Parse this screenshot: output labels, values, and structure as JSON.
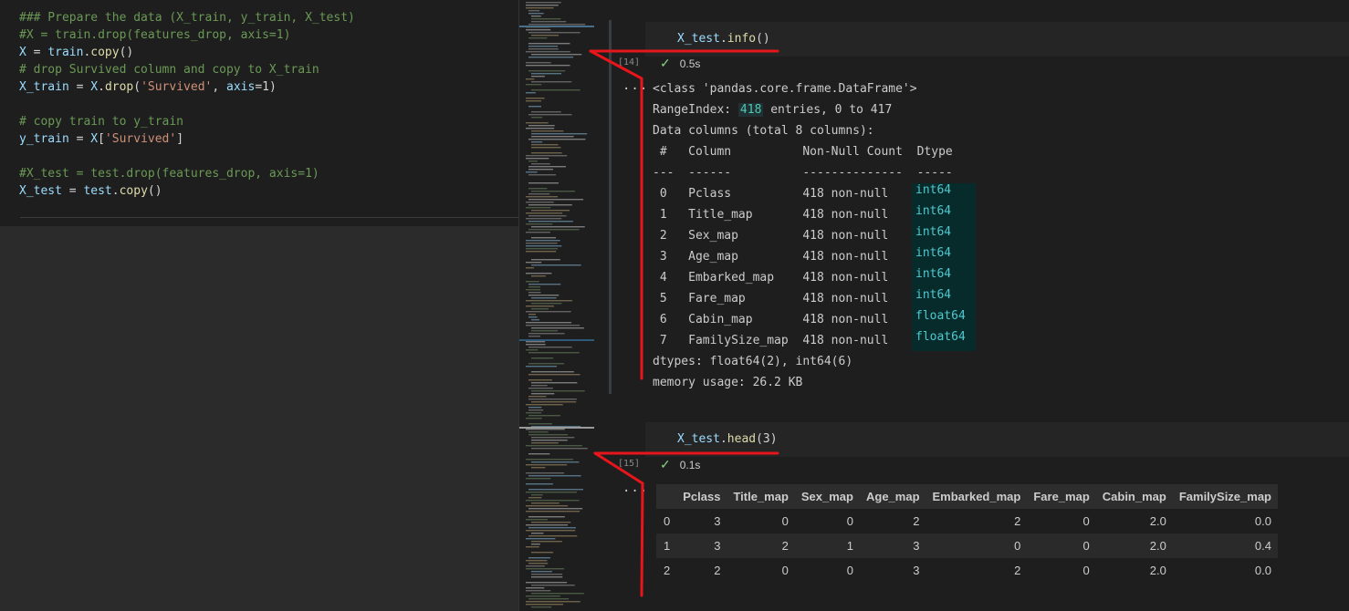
{
  "editor": {
    "lines": [
      {
        "parts": [
          {
            "t": "### Prepare the data (X_train, y_train, X_test)",
            "c": "c-com"
          }
        ]
      },
      {
        "parts": [
          {
            "t": "#X = train.drop(features_drop, axis=1)",
            "c": "c-com"
          }
        ]
      },
      {
        "parts": [
          {
            "t": "X",
            "c": "c-var"
          },
          {
            "t": " = ",
            "c": "c-op"
          },
          {
            "t": "train",
            "c": "c-var"
          },
          {
            "t": ".",
            "c": "c-op"
          },
          {
            "t": "copy",
            "c": "c-fn"
          },
          {
            "t": "()",
            "c": "c-op"
          }
        ]
      },
      {
        "parts": [
          {
            "t": "# drop Survived column and copy to X_train",
            "c": "c-com"
          }
        ]
      },
      {
        "parts": [
          {
            "t": "X_train",
            "c": "c-var"
          },
          {
            "t": " = ",
            "c": "c-op"
          },
          {
            "t": "X",
            "c": "c-var"
          },
          {
            "t": ".",
            "c": "c-op"
          },
          {
            "t": "drop",
            "c": "c-fn"
          },
          {
            "t": "(",
            "c": "c-op"
          },
          {
            "t": "'Survived'",
            "c": "c-str"
          },
          {
            "t": ", ",
            "c": "c-op"
          },
          {
            "t": "axis",
            "c": "c-var"
          },
          {
            "t": "=1)",
            "c": "c-op"
          }
        ]
      },
      {
        "parts": []
      },
      {
        "parts": [
          {
            "t": "# copy train to y_train",
            "c": "c-com"
          }
        ]
      },
      {
        "parts": [
          {
            "t": "y_train",
            "c": "c-var"
          },
          {
            "t": " = ",
            "c": "c-op"
          },
          {
            "t": "X",
            "c": "c-var"
          },
          {
            "t": "[",
            "c": "c-op"
          },
          {
            "t": "'Survived'",
            "c": "c-str"
          },
          {
            "t": "]",
            "c": "c-op"
          }
        ]
      },
      {
        "parts": []
      },
      {
        "parts": [
          {
            "t": "#X_test = test.drop(features_drop, axis=1)",
            "c": "c-com"
          }
        ]
      },
      {
        "parts": [
          {
            "t": "X_test",
            "c": "c-var"
          },
          {
            "t": " = ",
            "c": "c-op"
          },
          {
            "t": "test",
            "c": "c-var"
          },
          {
            "t": ".",
            "c": "c-op"
          },
          {
            "t": "copy",
            "c": "c-fn"
          },
          {
            "t": "()",
            "c": "c-op"
          }
        ]
      }
    ]
  },
  "cell14": {
    "code_obj": "X_test",
    "code_dot": ".",
    "code_fn": "info",
    "code_args": "()",
    "exec_count": "[14]",
    "check": "✓",
    "duration": "0.5s",
    "more": "...",
    "output": {
      "class_line": "<class 'pandas.core.frame.DataFrame'>",
      "range_prefix": "RangeIndex: ",
      "range_count": "418",
      "range_suffix": " entries, 0 to 417",
      "data_columns": "Data columns (total 8 columns):",
      "header": " #   Column          Non-Null Count  Dtype",
      "dashes": "---  ------          --------------  -----",
      "rows": [
        {
          "text": " 0   Pclass          418 non-null",
          "dtype": "int64"
        },
        {
          "text": " 1   Title_map       418 non-null",
          "dtype": "int64"
        },
        {
          "text": " 2   Sex_map         418 non-null",
          "dtype": "int64"
        },
        {
          "text": " 3   Age_map         418 non-null",
          "dtype": "int64"
        },
        {
          "text": " 4   Embarked_map    418 non-null",
          "dtype": "int64"
        },
        {
          "text": " 5   Fare_map        418 non-null",
          "dtype": "int64"
        },
        {
          "text": " 6   Cabin_map       418 non-null",
          "dtype": "float64"
        },
        {
          "text": " 7   FamilySize_map  418 non-null",
          "dtype": "float64"
        }
      ],
      "dtypes_line": "dtypes: float64(2), int64(6)",
      "memory_line": "memory usage: 26.2 KB"
    }
  },
  "cell15": {
    "code_obj": "X_test",
    "code_dot": ".",
    "code_fn": "head",
    "code_args": "(3)",
    "exec_count": "[15]",
    "check": "✓",
    "duration": "0.1s",
    "more": "...",
    "table": {
      "columns": [
        "",
        "Pclass",
        "Title_map",
        "Sex_map",
        "Age_map",
        "Embarked_map",
        "Fare_map",
        "Cabin_map",
        "FamilySize_map"
      ],
      "rows": [
        [
          "0",
          "3",
          "0",
          "0",
          "2",
          "2",
          "0",
          "2.0",
          "0.0"
        ],
        [
          "1",
          "3",
          "2",
          "1",
          "3",
          "0",
          "0",
          "2.0",
          "0.4"
        ],
        [
          "2",
          "2",
          "0",
          "0",
          "3",
          "2",
          "0",
          "2.0",
          "0.0"
        ]
      ]
    }
  },
  "colors": {
    "annotation": "#e8151b",
    "background": "#1e1e1e",
    "accent_check": "#89d185"
  }
}
